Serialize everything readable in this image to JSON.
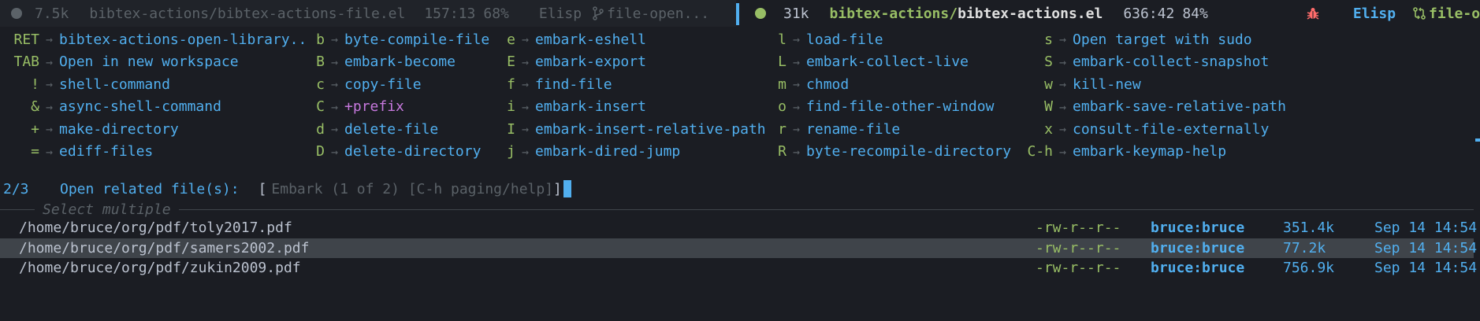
{
  "modeline_left": {
    "size": "7.5k",
    "file": "bibtex-actions/bibtex-actions-file.el",
    "position": "157:13",
    "percent": "68%",
    "mode": "Elisp",
    "vc": "file-open..."
  },
  "modeline_right": {
    "size": "31k",
    "dir": "bibtex-actions/",
    "base": "bibtex-actions.el",
    "position": "636:42",
    "percent": "84%",
    "mode": "Elisp",
    "vc": "file-open..."
  },
  "keymap": {
    "columns": [
      [
        {
          "key": "RET",
          "cmd": "bibtex-actions-open-library.."
        },
        {
          "key": "TAB",
          "cmd": "Open in new workspace"
        },
        {
          "key": "!",
          "cmd": "shell-command"
        },
        {
          "key": "&",
          "cmd": "async-shell-command"
        },
        {
          "key": "+",
          "cmd": "make-directory"
        },
        {
          "key": "=",
          "cmd": "ediff-files"
        }
      ],
      [
        {
          "key": "b",
          "cmd": "byte-compile-file"
        },
        {
          "key": "B",
          "cmd": "embark-become"
        },
        {
          "key": "c",
          "cmd": "copy-file"
        },
        {
          "key": "C",
          "cmd": "+prefix"
        },
        {
          "key": "d",
          "cmd": "delete-file"
        },
        {
          "key": "D",
          "cmd": "delete-directory"
        }
      ],
      [
        {
          "key": "e",
          "cmd": "embark-eshell"
        },
        {
          "key": "E",
          "cmd": "embark-export"
        },
        {
          "key": "f",
          "cmd": "find-file"
        },
        {
          "key": "i",
          "cmd": "embark-insert"
        },
        {
          "key": "I",
          "cmd": "embark-insert-relative-path"
        },
        {
          "key": "j",
          "cmd": "embark-dired-jump"
        }
      ],
      [
        {
          "key": "l",
          "cmd": "load-file"
        },
        {
          "key": "L",
          "cmd": "embark-collect-live"
        },
        {
          "key": "m",
          "cmd": "chmod"
        },
        {
          "key": "o",
          "cmd": "find-file-other-window"
        },
        {
          "key": "r",
          "cmd": "rename-file"
        },
        {
          "key": "R",
          "cmd": "byte-recompile-directory"
        }
      ],
      [
        {
          "key": "s",
          "cmd": "Open target with sudo"
        },
        {
          "key": "S",
          "cmd": "embark-collect-snapshot"
        },
        {
          "key": "w",
          "cmd": "kill-new"
        },
        {
          "key": "W",
          "cmd": "embark-save-relative-path"
        },
        {
          "key": "x",
          "cmd": "consult-file-externally"
        },
        {
          "key": "C-h",
          "cmd": "embark-keymap-help"
        }
      ]
    ]
  },
  "minibuffer": {
    "count": "2/3",
    "prompt": "Open related file(s):",
    "bracket_open": "[",
    "hint": "Embark (1 of 2) [C-h paging/help]",
    "bracket_close": "]"
  },
  "group_title": "Select multiple",
  "candidates": [
    {
      "path": "/home/bruce/org/pdf/toly2017.pdf",
      "perm": "-rw-r--r--",
      "owner": "bruce:bruce",
      "size": "351.4k",
      "date": "Sep 14 14:54",
      "current": false
    },
    {
      "path": "/home/bruce/org/pdf/samers2002.pdf",
      "perm": "-rw-r--r--",
      "owner": "bruce:bruce",
      "size": "77.2k",
      "date": "Sep 14 14:54",
      "current": true
    },
    {
      "path": "/home/bruce/org/pdf/zukin2009.pdf",
      "perm": "-rw-r--r--",
      "owner": "bruce:bruce",
      "size": "756.9k",
      "date": "Sep 14 14:54",
      "current": false
    }
  ],
  "colors": {
    "background": "#1b1d23",
    "modeline_inactive": "#202329",
    "accent_blue": "#51afef",
    "accent_green": "#98be65",
    "bug_red": "#ff6c6b",
    "selection": "#3f444a"
  },
  "icons": {
    "vc_inactive": "git-branch-icon",
    "vc_active": "git-compare-icon",
    "debug": "bug-icon"
  }
}
